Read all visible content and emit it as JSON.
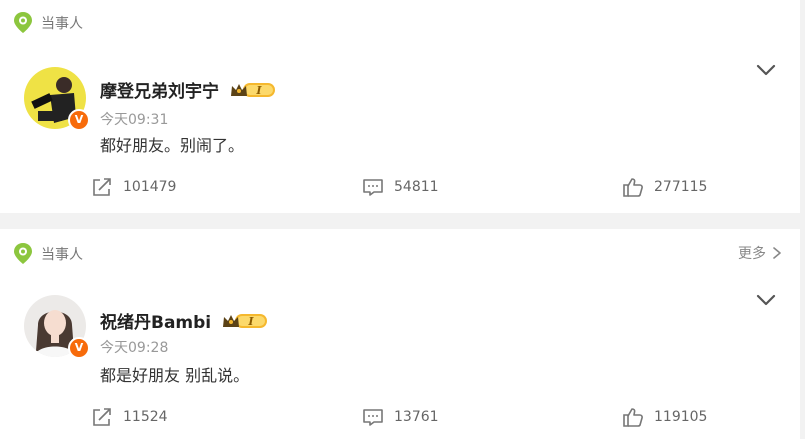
{
  "posts": [
    {
      "tag": "当事人",
      "user": {
        "name": "摩登兄弟刘宇宁",
        "verified_badge": "V",
        "vip_level": "I"
      },
      "time": "今天09:31",
      "content": "都好朋友。别闹了。",
      "stats": {
        "reposts": "101479",
        "comments": "54811",
        "likes": "277115"
      }
    },
    {
      "tag": "当事人",
      "more_label": "更多",
      "user": {
        "name": "祝绪丹Bambi",
        "verified_badge": "V",
        "vip_level": "I"
      },
      "time": "今天09:28",
      "content": "都是好朋友 别乱说。",
      "stats": {
        "reposts": "11524",
        "comments": "13761",
        "likes": "119105"
      }
    }
  ],
  "colors": {
    "tag_green": "#8cc63e",
    "badge_orange": "#f76b0b",
    "vip_gold": "#f5b82e"
  },
  "icons": [
    "location-pin-icon",
    "chevron-down-icon",
    "repost-icon",
    "comment-icon",
    "like-icon",
    "chevron-right-icon"
  ]
}
